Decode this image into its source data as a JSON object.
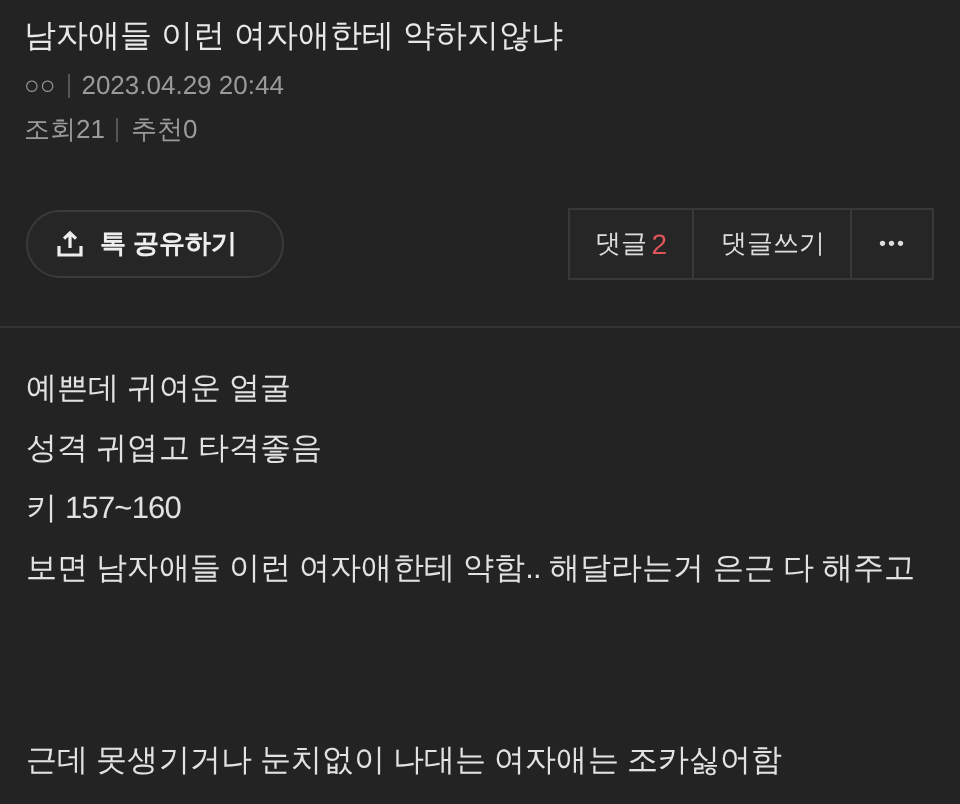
{
  "post": {
    "title": "남자애들 이런 여자애한테 약하지않냐",
    "author": "○○",
    "date": "2023.04.29 20:44",
    "views_label": "조회",
    "views": "21",
    "recommend_label": "추천",
    "recommend": "0"
  },
  "actions": {
    "share": "톡 공유하기",
    "comments_label": "댓글",
    "comments_count": "2",
    "write_comment": "댓글쓰기",
    "more": "•••"
  },
  "body": [
    {
      "lines": [
        "예쁜데 귀여운 얼굴",
        "성격 귀엽고 타격좋음",
        "키 157~160",
        "보면 남자애들 이런 여자애한테 약함.. 해달라는거 은근 다 해주고"
      ]
    },
    {
      "lines": [
        "근데 못생기거나 눈치없이 나대는 여자애는 조카싫어함"
      ]
    }
  ]
}
